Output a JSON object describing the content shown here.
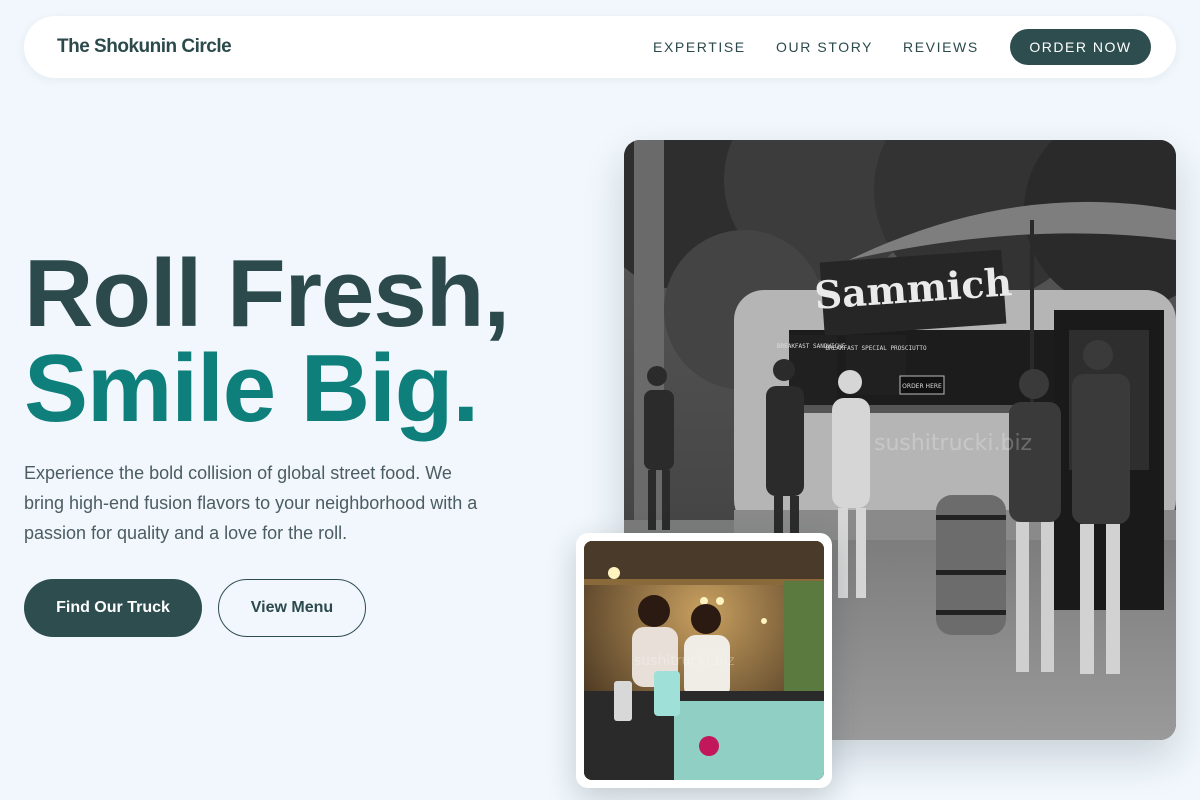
{
  "nav": {
    "brand": "The Shokunin Circle",
    "links": [
      "EXPERTISE",
      "OUR STORY",
      "REVIEWS"
    ],
    "cta": "ORDER NOW"
  },
  "hero": {
    "headline_line1": "Roll Fresh,",
    "headline_line2": "Smile Big.",
    "description": "Experience the bold collision of global street food. We bring high-end fusion flavors to your neighborhood with a passion for quality and a love for the roll.",
    "primary_button": "Find Our Truck",
    "secondary_button": "View Menu"
  },
  "images": {
    "main": {
      "sign": "Sammich",
      "menu_board_left": "BREAKFAST SANDWICHES",
      "menu_board_right": "BREAKFAST SPECIAL PROSCIUTTO",
      "order_sign": "ORDER HERE",
      "watermark": "sushitrucki.biz"
    },
    "inset": {
      "watermark": "sushitrucki.biz"
    }
  },
  "colors": {
    "primary": "#2e4d4f",
    "accent": "#0f7f7c",
    "background": "#f1f7fc"
  }
}
